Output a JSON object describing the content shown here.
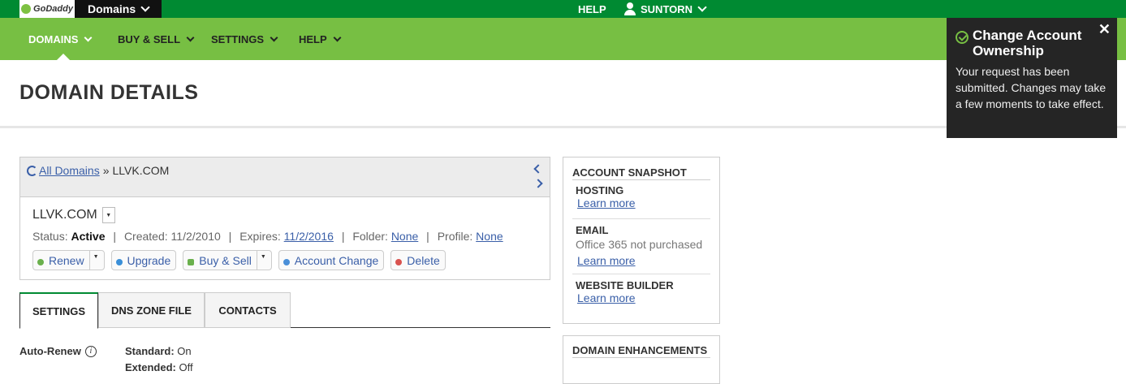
{
  "topbar": {
    "logo_text": "GoDaddy",
    "domains_menu": "Domains",
    "help": "HELP",
    "user": "SUNTORN"
  },
  "nav": {
    "items": [
      {
        "label": "DOMAINS"
      },
      {
        "label": "BUY & SELL"
      },
      {
        "label": "SETTINGS"
      },
      {
        "label": "HELP"
      }
    ]
  },
  "page": {
    "title": "DOMAIN DETAILS"
  },
  "breadcrumb": {
    "all_domains": "All Domains",
    "separator": "»",
    "current": "LLVK.COM"
  },
  "domain": {
    "name": "LLVK.COM",
    "status_label": "Status:",
    "status_value": "Active",
    "created_label": "Created:",
    "created_value": "11/2/2010",
    "expires_label": "Expires:",
    "expires_value": "11/2/2016",
    "folder_label": "Folder:",
    "folder_value": "None",
    "profile_label": "Profile:",
    "profile_value": "None"
  },
  "actions": [
    {
      "label": "Renew",
      "color": "#6ab04c"
    },
    {
      "label": "Upgrade",
      "color": "#3a8fd8"
    },
    {
      "label": "Buy & Sell",
      "color": "#6ab04c"
    },
    {
      "label": "Account Change",
      "color": "#4a8fd8"
    },
    {
      "label": "Delete",
      "color": "#d9534f"
    }
  ],
  "tabs": [
    {
      "label": "SETTINGS"
    },
    {
      "label": "DNS ZONE FILE"
    },
    {
      "label": "CONTACTS"
    }
  ],
  "autorenew": {
    "label": "Auto-Renew",
    "standard_label": "Standard:",
    "standard_value": "On",
    "extended_label": "Extended:",
    "extended_value": "Off"
  },
  "snapshot": {
    "title": "ACCOUNT SNAPSHOT",
    "hosting_title": "HOSTING",
    "hosting_link": "Learn more",
    "email_title": "EMAIL",
    "email_text": "Office 365 not purchased",
    "email_link": "Learn more",
    "builder_title": "WEBSITE BUILDER",
    "builder_link": "Learn more"
  },
  "enhancements": {
    "title": "DOMAIN ENHANCEMENTS"
  },
  "toast": {
    "title": "Change Account Ownership",
    "message": "Your request has been submitted. Changes may take a few moments to take effect."
  },
  "colors": {
    "topbar": "#008a32",
    "nav": "#77bf43",
    "link": "#3a5fa8",
    "toast_bg": "#252525"
  }
}
